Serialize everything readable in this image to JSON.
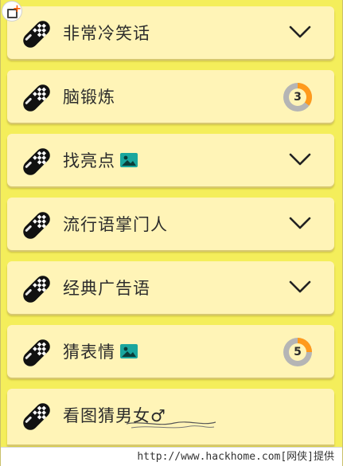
{
  "colors": {
    "background": "#f4ee5b",
    "card": "#fff4b7",
    "progress_fill": "#ff9a1c",
    "progress_track": "#b5b5b5",
    "image_badge": "#1aa69e"
  },
  "corner_icon": "add-screen-icon",
  "categories": [
    {
      "label": "非常冷笑话",
      "indicator": "chevron-down-icon",
      "has_image_badge": false
    },
    {
      "label": "脑锻炼",
      "indicator": "progress",
      "progress_value": "3",
      "progress_fraction": 0.35,
      "has_image_badge": false
    },
    {
      "label": "找亮点",
      "indicator": "chevron-down-icon",
      "has_image_badge": true
    },
    {
      "label": "流行语掌门人",
      "indicator": "chevron-down-icon",
      "has_image_badge": false
    },
    {
      "label": "经典广告语",
      "indicator": "chevron-down-icon",
      "has_image_badge": false
    },
    {
      "label": "猜表情",
      "indicator": "progress",
      "progress_value": "5",
      "progress_fraction": 0.25,
      "has_image_badge": true
    },
    {
      "label": "看图猜男女♂",
      "indicator": "none",
      "has_image_badge": false
    }
  ],
  "watermark": {
    "text": "http://www.hackhome.com[网侠]提供"
  }
}
